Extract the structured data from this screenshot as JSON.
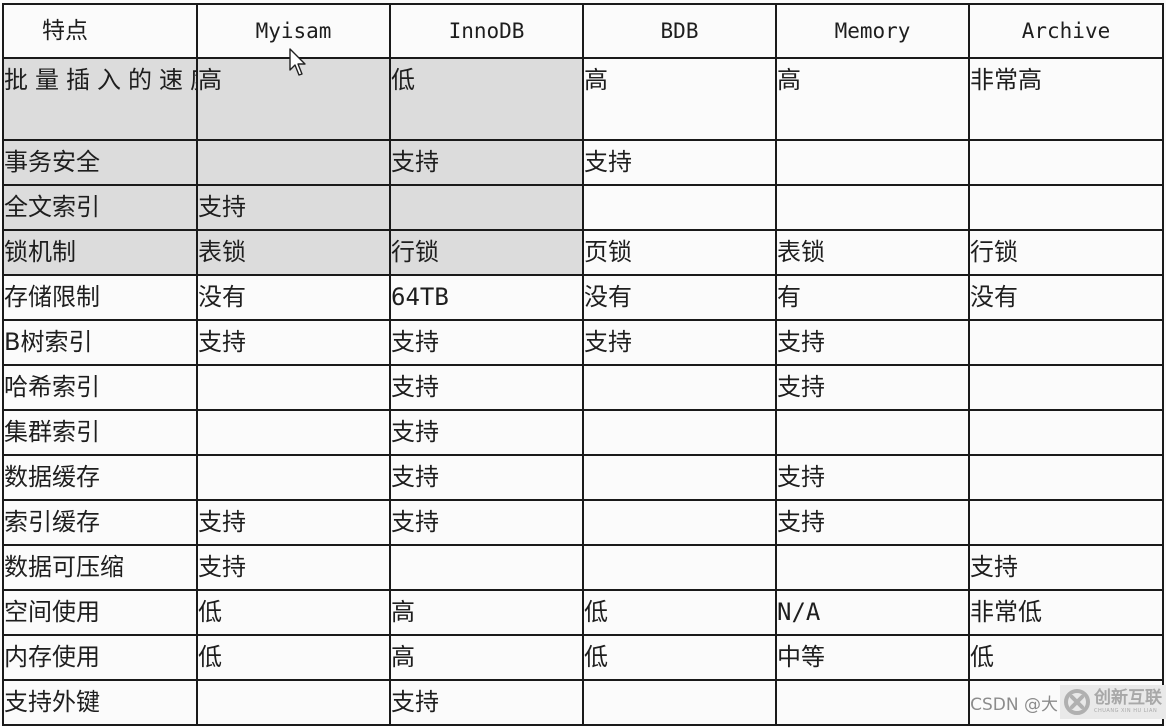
{
  "table": {
    "headers": [
      "特点",
      "Myisam",
      "InnoDB",
      "BDB",
      "Memory",
      "Archive"
    ],
    "rows": [
      {
        "feature": "批量插入的速度",
        "values": [
          "高",
          "低",
          "高",
          "高",
          "非常高"
        ]
      },
      {
        "feature": "事务安全",
        "values": [
          "",
          "支持",
          "支持",
          "",
          ""
        ]
      },
      {
        "feature": "全文索引",
        "values": [
          "支持",
          "",
          "",
          "",
          ""
        ]
      },
      {
        "feature": "锁机制",
        "values": [
          "表锁",
          "行锁",
          "页锁",
          "表锁",
          "行锁"
        ]
      },
      {
        "feature": "存储限制",
        "values": [
          "没有",
          "64TB",
          "没有",
          "有",
          "没有"
        ]
      },
      {
        "feature": "B树索引",
        "values": [
          "支持",
          "支持",
          "支持",
          "支持",
          ""
        ]
      },
      {
        "feature": "哈希索引",
        "values": [
          "",
          "支持",
          "",
          "支持",
          ""
        ]
      },
      {
        "feature": "集群索引",
        "values": [
          "",
          "支持",
          "",
          "",
          ""
        ]
      },
      {
        "feature": "数据缓存",
        "values": [
          "",
          "支持",
          "",
          "支持",
          ""
        ]
      },
      {
        "feature": "索引缓存",
        "values": [
          "支持",
          "支持",
          "",
          "支持",
          ""
        ]
      },
      {
        "feature": "数据可压缩",
        "values": [
          "支持",
          "",
          "",
          "",
          "支持"
        ]
      },
      {
        "feature": "空间使用",
        "values": [
          "低",
          "高",
          "低",
          "N/A",
          "非常低"
        ]
      },
      {
        "feature": "内存使用",
        "values": [
          "低",
          "高",
          "低",
          "中等",
          "低"
        ]
      },
      {
        "feature": "支持外键",
        "values": [
          "",
          "支持",
          "",
          "",
          ""
        ]
      }
    ],
    "highlight_color": "#dcdcdc"
  },
  "watermark": {
    "csdn_text": "CSDN @大",
    "brand_text": "创新互联",
    "brand_sub": "CHUANG XIN HU LIAN",
    "logo_icon": "brand-x-logo-icon"
  },
  "cursor_icon": "mouse-pointer-icon"
}
